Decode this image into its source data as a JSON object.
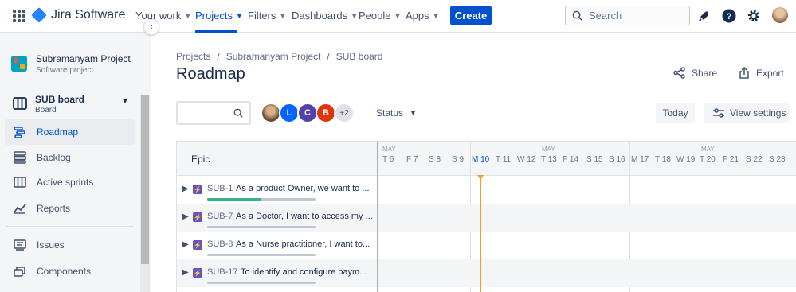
{
  "topnav": {
    "logo_text": "Jira Software",
    "items": [
      {
        "label": "Your work"
      },
      {
        "label": "Projects"
      },
      {
        "label": "Filters"
      },
      {
        "label": "Dashboards"
      },
      {
        "label": "People"
      },
      {
        "label": "Apps"
      }
    ],
    "create_label": "Create",
    "search_placeholder": "Search",
    "icons": [
      "notification-icon",
      "help-icon",
      "settings-icon"
    ]
  },
  "sidebar": {
    "project_name": "Subramanyam Project",
    "project_type": "Software project",
    "board_name": "SUB board",
    "board_sub": "Board",
    "items": [
      {
        "label": "Roadmap",
        "icon": "roadmap-icon"
      },
      {
        "label": "Backlog",
        "icon": "backlog-icon"
      },
      {
        "label": "Active sprints",
        "icon": "sprints-icon"
      },
      {
        "label": "Reports",
        "icon": "reports-icon"
      },
      {
        "label": "Issues",
        "icon": "issues-icon"
      },
      {
        "label": "Components",
        "icon": "components-icon"
      }
    ]
  },
  "main": {
    "breadcrumbs": [
      "Projects",
      "Subramanyam Project",
      "SUB board"
    ],
    "title": "Roadmap",
    "share_label": "Share",
    "export_label": "Export",
    "avatars": [
      {
        "initial": "",
        "color": "photo"
      },
      {
        "initial": "L",
        "color": "#0065ff"
      },
      {
        "initial": "C",
        "color": "#5243aa"
      },
      {
        "initial": "B",
        "color": "#de350b"
      },
      {
        "initial": "+2",
        "color": "#dfe1e6"
      }
    ],
    "status_label": "Status",
    "today_label": "Today",
    "view_settings_label": "View settings"
  },
  "timeline": {
    "epic_header": "Epic",
    "weeks": [
      {
        "month": "MAY",
        "days": [
          "T 6",
          "F 7",
          "S 8",
          "S 9"
        ]
      },
      {
        "month": "MAY",
        "days": [
          "M 10",
          "T 11",
          "W 12",
          "T 13",
          "F 14",
          "S 15",
          "S 16"
        ]
      },
      {
        "month": "MAY",
        "days": [
          "M 17",
          "T 18",
          "W 19",
          "T 20",
          "F 21",
          "S 22",
          "S 23"
        ]
      }
    ],
    "today_day": "M 10",
    "rows": [
      {
        "key": "SUB-1",
        "summary": "As a product Owner, we want to ...",
        "progress": 0.5
      },
      {
        "key": "SUB-7",
        "summary": "As a Doctor, I want to access my ...",
        "progress": 0
      },
      {
        "key": "SUB-8",
        "summary": "As a Nurse practitioner, I want to...",
        "progress": 0
      },
      {
        "key": "SUB-17",
        "summary": "To identify and configure paym...",
        "progress": 0
      }
    ]
  },
  "colors": {
    "brand": "#0052cc",
    "epic": "#6554c0",
    "progress": "#36b37e",
    "today_line": "#ff991f"
  }
}
